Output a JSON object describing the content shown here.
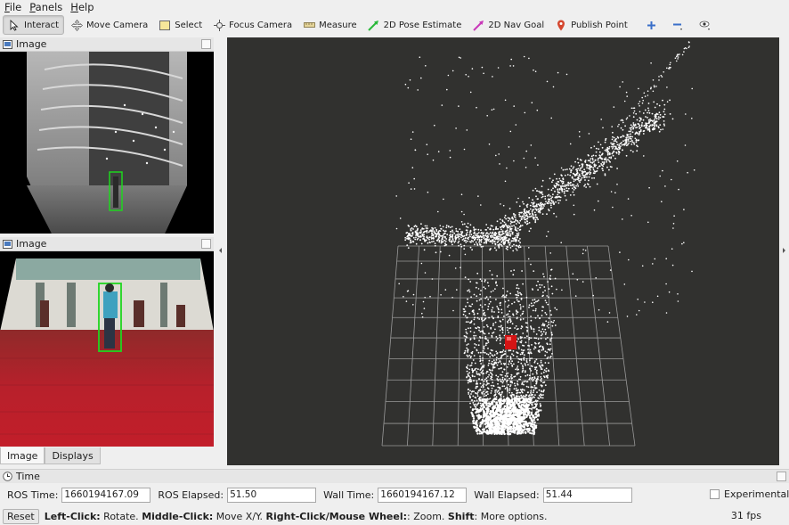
{
  "menubar": {
    "items": [
      {
        "accel": "F",
        "rest": "ile"
      },
      {
        "accel": "P",
        "rest": "anels"
      },
      {
        "accel": "H",
        "rest": "elp"
      }
    ]
  },
  "toolbar": {
    "tools": [
      {
        "label": "Interact",
        "icon": "interact-cursor-icon",
        "active": true
      },
      {
        "label": "Move Camera",
        "icon": "move-camera-icon",
        "active": false
      },
      {
        "label": "Select",
        "icon": "select-box-icon",
        "active": false
      },
      {
        "label": "Focus Camera",
        "icon": "focus-camera-icon",
        "active": false
      },
      {
        "label": "Measure",
        "icon": "ruler-icon",
        "active": false
      },
      {
        "label": "2D Pose Estimate",
        "icon": "green-arrow-icon",
        "active": false
      },
      {
        "label": "2D Nav Goal",
        "icon": "pink-arrow-icon",
        "active": false
      },
      {
        "label": "Publish Point",
        "icon": "map-pin-icon",
        "active": false
      }
    ],
    "extra_icons": [
      "plus-icon",
      "minus-icon",
      "eye-icon"
    ]
  },
  "left_dock": {
    "top_panel_title": "Image",
    "bottom_panel_title": "Image",
    "tabs": [
      {
        "label": "Image",
        "selected": true
      },
      {
        "label": "Displays",
        "selected": false
      }
    ]
  },
  "time_panel": {
    "title": "Time",
    "ros_time_label": "ROS Time:",
    "ros_time_value": "1660194167.09",
    "ros_elapsed_label": "ROS Elapsed:",
    "ros_elapsed_value": "51.50",
    "wall_time_label": "Wall Time:",
    "wall_time_value": "1660194167.12",
    "wall_elapsed_label": "Wall Elapsed:",
    "wall_elapsed_value": "51.44",
    "experimental_label": "Experimental",
    "experimental_checked": false
  },
  "status_bar": {
    "reset_label": "Reset",
    "help_parts": [
      {
        "text": "Left-Click:",
        "bold": true
      },
      {
        "text": " Rotate. ",
        "bold": false
      },
      {
        "text": "Middle-Click:",
        "bold": true
      },
      {
        "text": " Move X/Y. ",
        "bold": false
      },
      {
        "text": "Right-Click/Mouse Wheel:",
        "bold": true
      },
      {
        "text": ": Zoom. ",
        "bold": false
      },
      {
        "text": "Shift",
        "bold": true
      },
      {
        "text": ": More options.",
        "bold": false
      }
    ],
    "fps": "31 fps"
  },
  "colors": {
    "viewport_bg": "#31312f",
    "grid_line": "#9a9a9a",
    "point_cloud": "#ffffff",
    "marker": "#d41414",
    "detection_box": "#1fd61f"
  }
}
